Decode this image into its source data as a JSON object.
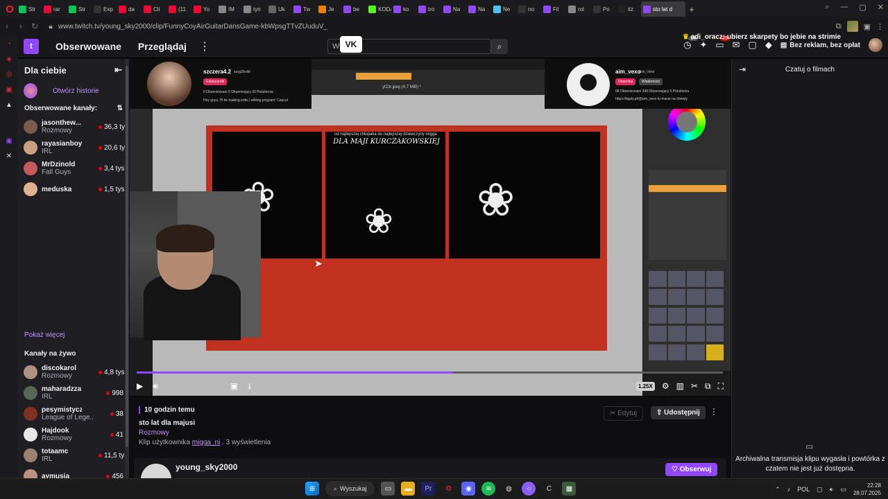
{
  "browser": {
    "tabs": [
      {
        "label": "Str",
        "color": "#00c853"
      },
      {
        "label": "rar",
        "color": "#ff0033"
      },
      {
        "label": "Str",
        "color": "#00c853"
      },
      {
        "label": "Exp",
        "color": "#333333"
      },
      {
        "label": "da",
        "color": "#ff0033"
      },
      {
        "label": "Cli",
        "color": "#ff0033"
      },
      {
        "label": "(11",
        "color": "#ff0033"
      },
      {
        "label": "Yo",
        "color": "#ff0033"
      },
      {
        "label": "IM",
        "color": "#888888"
      },
      {
        "label": "tyn",
        "color": "#888888"
      },
      {
        "label": "Uk",
        "color": "#666666"
      },
      {
        "label": "Tw",
        "color": "#9147ff"
      },
      {
        "label": "Je",
        "color": "#f57c00"
      },
      {
        "label": "be",
        "color": "#9147ff"
      },
      {
        "label": "KODAS",
        "color": "#53fc18"
      },
      {
        "label": "ko",
        "color": "#9147ff"
      },
      {
        "label": "tro",
        "color": "#9147ff"
      },
      {
        "label": "Na",
        "color": "#9147ff"
      },
      {
        "label": "Na",
        "color": "#9147ff"
      },
      {
        "label": "Ne",
        "color": "#4fc3f7"
      },
      {
        "label": "no",
        "color": "#333333"
      },
      {
        "label": "Fil",
        "color": "#9147ff"
      },
      {
        "label": "rol",
        "color": "#888888"
      },
      {
        "label": "Po",
        "color": "#333333"
      },
      {
        "label": "itz",
        "color": "#222222"
      }
    ],
    "active_tab": "sto lat d",
    "new_tab": "+",
    "url": "www.twitch.tv/young_sky2000/clip/FunnyCoyAirGuitarDansGame-kbWpsgTTvZUuduV_"
  },
  "header": {
    "logo": "t",
    "nav_following": "Obserwowane",
    "nav_browse": "Przeglądaj",
    "more": "⋮",
    "search_placeholder": "W",
    "vk_badge": "VK",
    "notif_count": "14",
    "inbox_count": "29",
    "no_ads": "Bez reklam, bez opłat"
  },
  "chat_banner": {
    "user": "adi_oracz",
    "message": ": ubierz skarpety bo jebie na strimie"
  },
  "sidebar": {
    "title": "Dla ciebie",
    "collapse": "⇤",
    "stories_link": "Otwórz historie",
    "followed_title": "Obserwowane kanały:",
    "followed": [
      {
        "name": "jasonthew...",
        "category": "Rozmowy",
        "viewers": "36,3 tys.",
        "color": "#7a5a4a"
      },
      {
        "name": "rayasianboy",
        "category": "IRL",
        "viewers": "20,6 tys.",
        "color": "#caa080"
      },
      {
        "name": "MrDzinold",
        "category": "Fall Guys",
        "viewers": "3,4 tys.",
        "color": "#c45a5a"
      },
      {
        "name": "meduska",
        "category": "",
        "viewers": "1,5 tys.",
        "color": "#e0b090"
      }
    ],
    "show_more": "Pokaż więcej",
    "live_title": "Kanały na żywo",
    "live": [
      {
        "name": "discokarol",
        "category": "Rozmowy",
        "viewers": "4,8 tys.",
        "color": "#b09080"
      },
      {
        "name": "maharadzza",
        "category": "IRL",
        "viewers": "998",
        "color": "#556655"
      },
      {
        "name": "pesymistyczny...",
        "category": "League of Lege...",
        "viewers": "38",
        "color": "#803020"
      },
      {
        "name": "Hajdook",
        "category": "Rozmowy",
        "viewers": "41",
        "color": "#e8e8e8"
      },
      {
        "name": "totaamc",
        "category": "IRL",
        "viewers": "11,5 tys.",
        "color": "#9a8070"
      },
      {
        "name": "aymusia",
        "category": "",
        "viewers": "456",
        "color": "#c09080"
      }
    ]
  },
  "video": {
    "left_card": {
      "name": "szczera4.2",
      "handle": "szyg2build",
      "button": "Edytuj profil",
      "stats": "0 Obserwowani   5 Obserwujący   30 Polubienia",
      "bio": "Hey guys, I'll be making edits | editing program: Capcut"
    },
    "right_card": {
      "name": "aim_vexo",
      "handle": "Aim_Vexo",
      "button": "Obserwuj",
      "button2": "Wiadomość",
      "stats": "98 Obserwowani   398 Obserwujący   6 Polubienia",
      "bio": "https://tipply.pl/@aim_vexo tu macie na donejty"
    },
    "panel_caption_small": "od najlepszej chłopaka do najlepszej dziewczyny migga",
    "panel_caption": "DLA MAJI KURCZAKOWSKIEJ",
    "toolbar_text": "yf23r.jpeg (4,7 MiB) *",
    "progress_fraction": 0.54,
    "speed": "1.25X"
  },
  "clip": {
    "time_ago": "10 godzin temu",
    "title": "sto lat dla majusi",
    "category": "Rozmowy",
    "by_prefix": "Klip użytkownika",
    "by_user": "migga_ni",
    "views": ". 3 wyświetlenia",
    "edit": "Edytuj",
    "share": "Udostępnij",
    "more": "⋮",
    "channel": "young_sky2000",
    "follow": "Obserwuj"
  },
  "chat": {
    "title": "Czatuj o filmach",
    "collapse": "⇥",
    "icon": "▭",
    "message": "Archiwalna transmisja klipu wygasła i powtórka z czatem nie jest już dostępna."
  },
  "taskbar": {
    "search": "Wyszukaj",
    "lang": "POL",
    "time": "22:28",
    "date": "28.07.2025"
  }
}
